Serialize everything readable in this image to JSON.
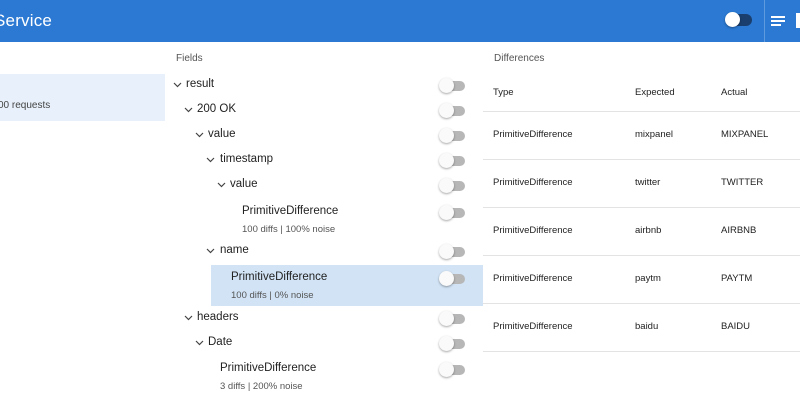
{
  "header": {
    "title": "Service",
    "colors": {
      "bar": "#2b79d3"
    },
    "toggle_icon": "toggle-switch-icon",
    "menu_icon": "list-menu-icon"
  },
  "requests": {
    "summary": "00 requests"
  },
  "fields": {
    "title": "Fields",
    "nodes": [
      {
        "label": "result"
      },
      {
        "label": "200 OK"
      },
      {
        "label": "value"
      },
      {
        "label": "timestamp"
      },
      {
        "label": "value"
      },
      {
        "label": "PrimitiveDifference",
        "stats": "100 diffs | 100% noise"
      },
      {
        "label": "name"
      },
      {
        "label": "PrimitiveDifference",
        "stats": "100 diffs | 0% noise"
      },
      {
        "label": "headers"
      },
      {
        "label": "Date"
      },
      {
        "label": "PrimitiveDifference",
        "stats": "3 diffs | 200% noise"
      }
    ]
  },
  "differences": {
    "title": "Differences",
    "columns": [
      "Type",
      "Expected",
      "Actual"
    ],
    "rows": [
      [
        "PrimitiveDifference",
        "mixpanel",
        "MIXPANEL"
      ],
      [
        "PrimitiveDifference",
        "twitter",
        "TWITTER"
      ],
      [
        "PrimitiveDifference",
        "airbnb",
        "AIRBNB"
      ],
      [
        "PrimitiveDifference",
        "paytm",
        "PAYTM"
      ],
      [
        "PrimitiveDifference",
        "baidu",
        "BAIDU"
      ]
    ]
  }
}
